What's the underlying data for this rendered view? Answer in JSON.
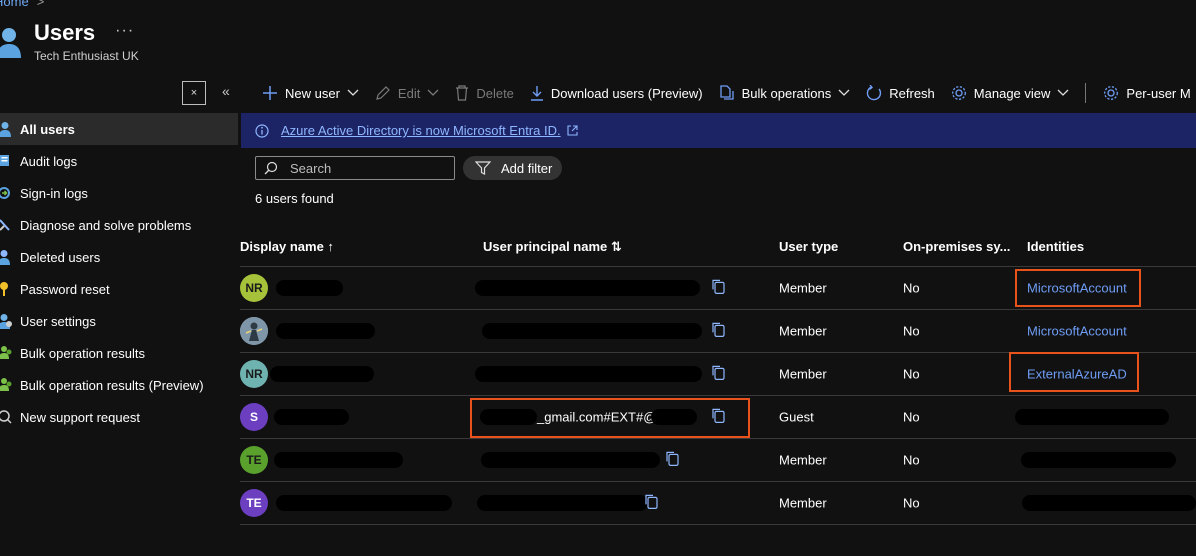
{
  "breadcrumb": {
    "home": "Home",
    "sep": ">"
  },
  "header": {
    "title": "Users",
    "more": "···",
    "tenant": "Tech Enthusiast UK"
  },
  "collapse": {
    "close": "×",
    "chevrons": "«"
  },
  "sidebar": {
    "items": [
      {
        "label": "All users",
        "icon": "user-icon",
        "active": true
      },
      {
        "label": "Audit logs",
        "icon": "audit-log-icon"
      },
      {
        "label": "Sign-in logs",
        "icon": "sign-in-icon"
      },
      {
        "label": "Diagnose and solve problems",
        "icon": "wrench-icon"
      },
      {
        "label": "Deleted users",
        "icon": "deleted-user-icon"
      },
      {
        "label": "Password reset",
        "icon": "key-icon"
      },
      {
        "label": "User settings",
        "icon": "user-settings-icon"
      },
      {
        "label": "Bulk operation results",
        "icon": "bulk-results-icon"
      },
      {
        "label": "Bulk operation results (Preview)",
        "icon": "bulk-results-icon"
      },
      {
        "label": "New support request",
        "icon": "support-icon"
      }
    ]
  },
  "toolbar": {
    "new_user": "New user",
    "edit": "Edit",
    "delete": "Delete",
    "download": "Download users (Preview)",
    "bulk": "Bulk operations",
    "refresh": "Refresh",
    "manage_view": "Manage view",
    "per_user": "Per-user M"
  },
  "banner": {
    "text": "Azure Active Directory is now Microsoft Entra ID."
  },
  "search": {
    "placeholder": "Search"
  },
  "filter": {
    "label": "Add filter"
  },
  "count": "6 users found",
  "columns": {
    "display": "Display name ↑",
    "upn": "User principal name ⇅",
    "type": "User type",
    "onprem": "On-premises sy...",
    "identities": "Identities"
  },
  "rows": [
    {
      "initials": "NR",
      "avatar_color": "#a6c13a",
      "type": "Member",
      "onprem": "No",
      "identity": "MicrosoftAccount"
    },
    {
      "initials": "",
      "avatar_color": "#8fa7b8",
      "type": "Member",
      "onprem": "No",
      "identity": "MicrosoftAccount"
    },
    {
      "initials": "NR",
      "avatar_color": "#6fb3b0",
      "type": "Member",
      "onprem": "No",
      "identity": "ExternalAzureAD"
    },
    {
      "initials": "S",
      "avatar_color": "#6b3fc0",
      "type": "Guest",
      "onprem": "No",
      "identity": "",
      "upn_text": "_gmail.com#EXT#@"
    },
    {
      "initials": "TE",
      "avatar_color": "#5aa02c",
      "type": "Member",
      "onprem": "No",
      "identity": ""
    },
    {
      "initials": "TE",
      "avatar_color": "#6b3fc0",
      "type": "Member",
      "onprem": "No",
      "identity": ""
    }
  ],
  "colors": {
    "accent": "#6f9df5",
    "highlight": "#e8531c",
    "banner": "#1d2466"
  }
}
